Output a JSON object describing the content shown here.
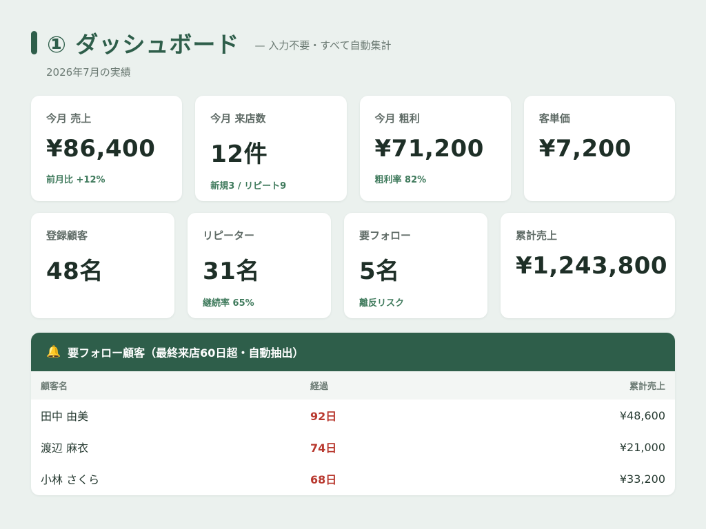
{
  "header": {
    "title": "① ダッシュボード",
    "subtitle": "— 入力不要・すべて自動集計",
    "period": "2026年7月の実績"
  },
  "kpi_row1": [
    {
      "label": "今月 売上",
      "value": "¥86,400",
      "note": "前月比 +12%"
    },
    {
      "label": "今月 来店数",
      "value": "12件",
      "note": "新規3 / リピート9"
    },
    {
      "label": "今月 粗利",
      "value": "¥71,200",
      "note": "粗利率 82%"
    },
    {
      "label": "客単価",
      "value": "¥7,200",
      "note": ""
    }
  ],
  "kpi_row2": [
    {
      "label": "登録顧客",
      "value": "48名",
      "note": ""
    },
    {
      "label": "リピーター",
      "value": "31名",
      "note": "継続率 65%"
    },
    {
      "label": "要フォロー",
      "value": "5名",
      "note": "離反リスク"
    },
    {
      "label": "累計売上",
      "value": "¥1,243,800",
      "note": ""
    }
  ],
  "follow": {
    "title": "要フォロー顧客（最終来店60日超・自動抽出）",
    "icon": "bell-icon",
    "columns": {
      "name": "顧客名",
      "elapsed": "経過",
      "total": "累計売上"
    },
    "rows": [
      {
        "name": "田中 由美",
        "elapsed": "92日",
        "total": "¥48,600"
      },
      {
        "name": "渡辺 麻衣",
        "elapsed": "74日",
        "total": "¥21,000"
      },
      {
        "name": "小林 さくら",
        "elapsed": "68日",
        "total": "¥33,200"
      }
    ]
  },
  "colors": {
    "accent": "#2e5e4a",
    "alert": "#b8382e",
    "positive": "#3f7a5c",
    "background": "#ebf1ee"
  }
}
